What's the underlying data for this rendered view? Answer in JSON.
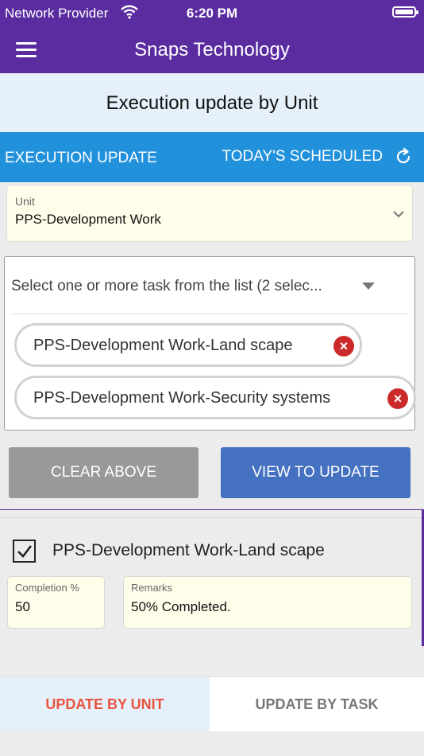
{
  "status_bar": {
    "carrier": "Network Provider",
    "time": "6:20 PM"
  },
  "app_bar": {
    "title": "Snaps Technology"
  },
  "page_title": "Execution update by Unit",
  "tabs": {
    "execution_update": "EXECUTION UPDATE",
    "todays_scheduled": "TODAY'S SCHEDULED"
  },
  "unit": {
    "label": "Unit",
    "value": "PPS-Development Work"
  },
  "task_select": {
    "placeholder": "Select one or more task from the list (2 selec...",
    "chips": [
      "PPS-Development Work-Land scape",
      "PPS-Development Work-Security systems"
    ]
  },
  "buttons": {
    "clear": "CLEAR ABOVE",
    "view": "VIEW TO UPDATE"
  },
  "task_item": {
    "checked": true,
    "title": "PPS-Development Work-Land scape",
    "completion_label": "Completion %",
    "completion_value": "50",
    "remarks_label": "Remarks",
    "remarks_value": "50% Completed."
  },
  "bottom_tabs": {
    "by_unit": "UPDATE BY UNIT",
    "by_task": "UPDATE BY TASK"
  },
  "colors": {
    "primary": "#5a2ca0",
    "tab_blue": "#2291dc",
    "view_button": "#4471c0",
    "remove_chip": "#cc2a2a",
    "active_tab_text": "#e8553e"
  }
}
